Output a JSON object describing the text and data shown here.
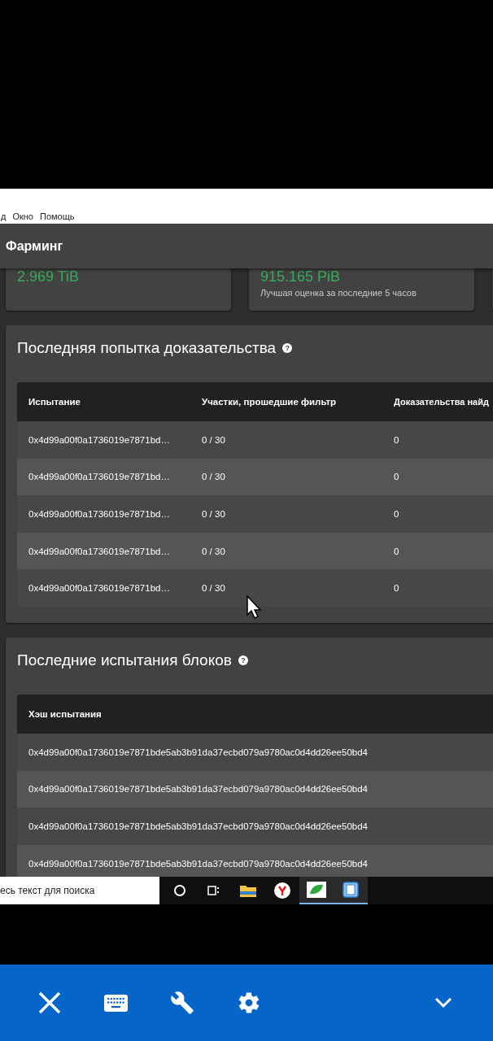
{
  "menu_bar": {
    "items": [
      "д",
      "Окно",
      "Помощь"
    ]
  },
  "app_header": {
    "title": "Фарминг"
  },
  "stat_cards": [
    {
      "value": "2.969 TiB"
    },
    {
      "value": "915.165 PiB",
      "caption": "Лучшая оценка за последние 5 часов"
    }
  ],
  "proof_panel": {
    "title": "Последняя попытка доказательства",
    "help_icon": "?",
    "columns": [
      "Испытание",
      "Участки, прошедшие фильтр",
      "Доказательства найд"
    ],
    "rows": [
      [
        "0x4d99a00f0a1736019e7871bd…",
        "0 / 30",
        "0"
      ],
      [
        "0x4d99a00f0a1736019e7871bd…",
        "0 / 30",
        "0"
      ],
      [
        "0x4d99a00f0a1736019e7871bd…",
        "0 / 30",
        "0"
      ],
      [
        "0x4d99a00f0a1736019e7871bd…",
        "0 / 30",
        "0"
      ],
      [
        "0x4d99a00f0a1736019e7871bd…",
        "0 / 30",
        "0"
      ]
    ]
  },
  "blocks_panel": {
    "title": "Последние испытания блоков",
    "help_icon": "?",
    "columns": [
      "Хэш испытания"
    ],
    "rows": [
      [
        "0x4d99a00f0a1736019e7871bde5ab3b91da37ecbd079a9780ac0d4dd26ee50bd4"
      ],
      [
        "0x4d99a00f0a1736019e7871bde5ab3b91da37ecbd079a9780ac0d4dd26ee50bd4"
      ],
      [
        "0x4d99a00f0a1736019e7871bde5ab3b91da37ecbd079a9780ac0d4dd26ee50bd4"
      ],
      [
        "0x4d99a00f0a1736019e7871bde5ab3b91da37ecbd079a9780ac0d4dd26ee50bd4"
      ]
    ]
  },
  "taskbar": {
    "search": {
      "placeholder": "есь текст для поиска"
    },
    "apps": [
      {
        "kind": "cortana",
        "running": false
      },
      {
        "kind": "taskview",
        "running": false
      },
      {
        "kind": "folder",
        "running": false
      },
      {
        "kind": "browser",
        "running": false
      },
      {
        "kind": "leaf",
        "running": true
      },
      {
        "kind": "disk",
        "running": true
      }
    ]
  },
  "remote_toolbar": {
    "buttons": [
      {
        "kind": "close"
      },
      {
        "kind": "keyboard"
      },
      {
        "kind": "wrench"
      },
      {
        "kind": "settings"
      },
      {
        "kind": "collapse"
      }
    ]
  }
}
